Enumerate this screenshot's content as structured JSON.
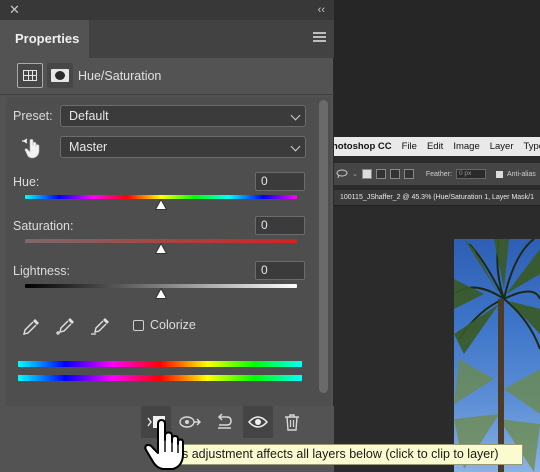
{
  "background_app": {
    "menubar": {
      "app_name": "hotoshop CC",
      "items": [
        "File",
        "Edit",
        "Image",
        "Layer",
        "Type"
      ]
    },
    "options_bar": {
      "feather_label": "Feather:",
      "feather_value": "0 px",
      "antialias_label": "Anti-alias"
    },
    "document_tab": "100115_JShaffer_2 @ 45.3% (Hue/Saturation 1, Layer Mask/1"
  },
  "panel": {
    "tab_label": "Properties",
    "adjustment_title": "Hue/Saturation",
    "preset": {
      "label": "Preset:",
      "value": "Default"
    },
    "channel": {
      "value": "Master"
    },
    "hue": {
      "label": "Hue:",
      "value": "0",
      "position": 0.5
    },
    "saturation": {
      "label": "Saturation:",
      "value": "0",
      "position": 0.5
    },
    "lightness": {
      "label": "Lightness:",
      "value": "0",
      "position": 0.5
    },
    "colorize_label": "Colorize",
    "colorize_checked": false
  },
  "tooltip": "s adjustment affects all layers below (click to clip to layer)",
  "colors": {
    "panel_bg": "#535353",
    "tooltip_bg": "#fbfbd0",
    "accent_red": "#d42020"
  },
  "icons": {
    "close": "close-icon",
    "collapse": "double-chevron-icon",
    "panel_menu": "hamburger-icon",
    "targeted_adjust": "hand-adjust-icon",
    "eyedroppers": [
      "eyedropper-icon",
      "eyedropper-plus-icon",
      "eyedropper-minus-icon"
    ],
    "footer": [
      "clip-to-layer-icon",
      "view-previous-state-icon",
      "reset-icon",
      "visibility-eye-icon",
      "trash-icon"
    ]
  }
}
